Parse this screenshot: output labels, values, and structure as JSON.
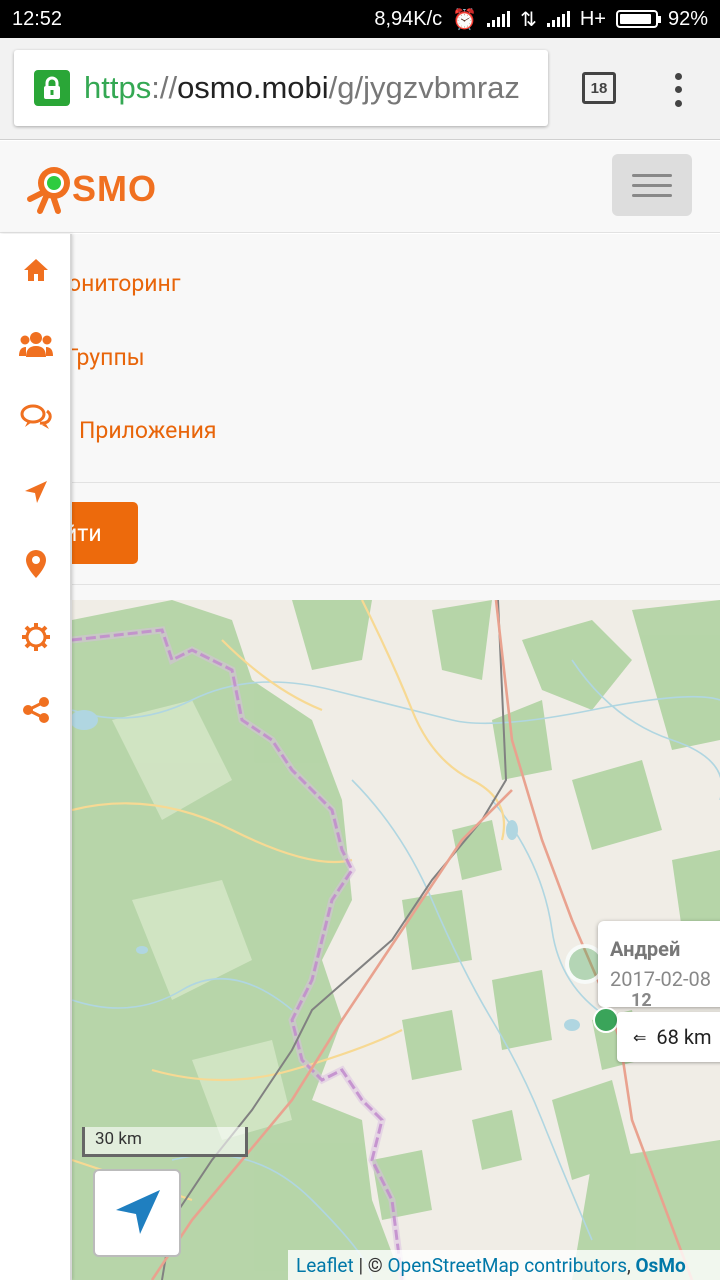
{
  "status_bar": {
    "time": "12:52",
    "speed": "8,94K/c",
    "network": "H+",
    "battery": "92%"
  },
  "browser": {
    "url_protocol": "https",
    "url_sep": "://",
    "url_host": "osmo.mobi",
    "url_path": "/g/jygzvbmraz",
    "tab_count": "18"
  },
  "site": {
    "logo_text": "SMO",
    "brand_color": "#ed6a0c"
  },
  "nav": {
    "items": [
      {
        "label": "Мониторинг",
        "visible_text": "ониторинг"
      },
      {
        "label": "Группы",
        "visible_text": "Группы"
      },
      {
        "label": "Приложения",
        "visible_text": "Приложения"
      }
    ],
    "login_label": "йти"
  },
  "sidebar": {
    "icons": [
      "home-icon",
      "users-icon",
      "chat-icon",
      "navigate-icon",
      "map-pin-icon",
      "settings-icon",
      "share-icon"
    ]
  },
  "map": {
    "tracker_name": "Андрей",
    "tracker_date": "2017-02-08",
    "speed_value": "12",
    "distance": "68 km",
    "scale_label": "30 km",
    "attribution": {
      "leaflet": "Leaflet",
      "separator": " | © ",
      "osm": "OpenStreetMap contributors",
      "comma": ", ",
      "osmo": "OsMo"
    }
  }
}
